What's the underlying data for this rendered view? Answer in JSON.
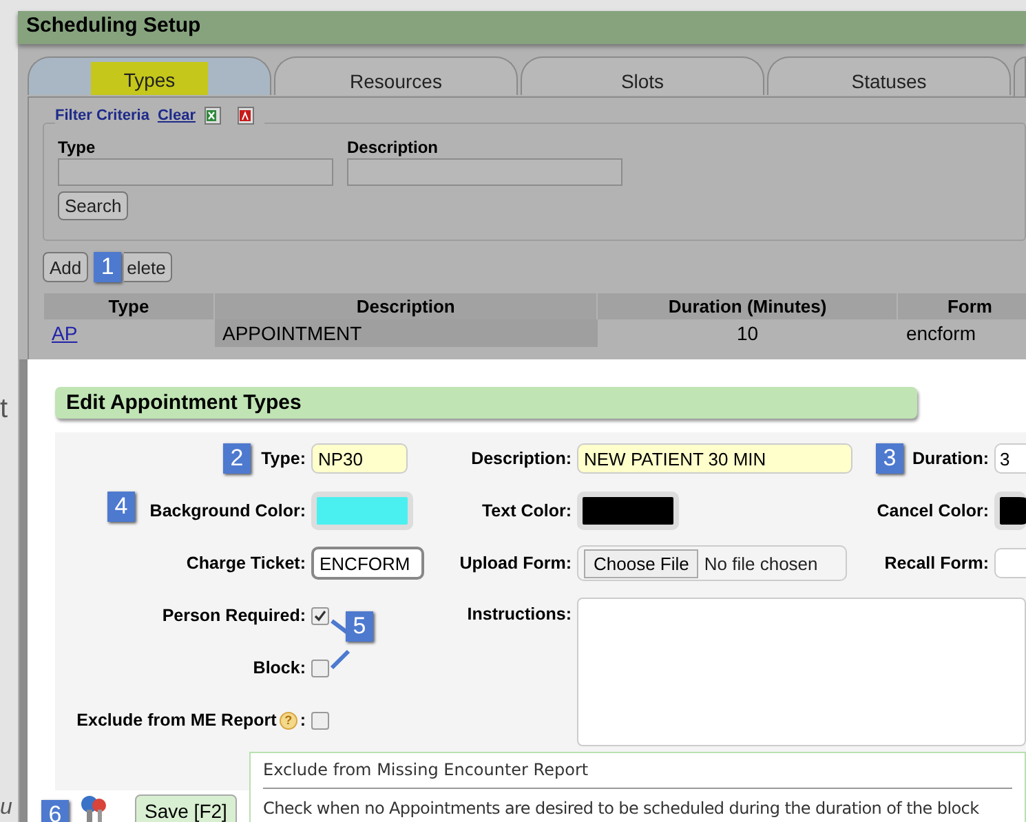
{
  "header": {
    "title": "Scheduling Setup"
  },
  "tabs": [
    {
      "label": "Types",
      "selected": true
    },
    {
      "label": "Resources",
      "selected": false
    },
    {
      "label": "Slots",
      "selected": false
    },
    {
      "label": "Statuses",
      "selected": false
    }
  ],
  "filter": {
    "legend": "Filter Criteria",
    "clear_link": "Clear",
    "fields": [
      {
        "label": "Type"
      },
      {
        "label": "Description"
      }
    ],
    "search_button": "Search"
  },
  "actions": [
    {
      "label": "Add"
    },
    {
      "label": "elete"
    }
  ],
  "table": {
    "columns": [
      "Type",
      "Description",
      "Duration (Minutes)",
      "Form"
    ],
    "rows": [
      {
        "cells": [
          "AP",
          "APPOINTMENT",
          "10",
          "encform"
        ]
      }
    ]
  },
  "edge_texts": [
    "t",
    "u"
  ],
  "dialog": {
    "title": "Edit Appointment Types",
    "rows": [
      [
        {
          "kind": "text",
          "label": "Type:",
          "value": "NP30",
          "highlighted": true
        },
        {
          "kind": "text",
          "label": "Description:",
          "value": "NEW PATIENT 30 MIN",
          "highlighted": true
        },
        {
          "kind": "text",
          "label": "Duration:",
          "value": "3",
          "highlighted": false
        }
      ],
      [
        {
          "kind": "color",
          "label": "Background Color:",
          "color": "#4af0f0"
        },
        {
          "kind": "color",
          "label": "Text Color:",
          "color": "#000000"
        },
        {
          "kind": "color",
          "label": "Cancel Color:",
          "color": "#000000"
        }
      ],
      [
        {
          "kind": "text",
          "label": "Charge Ticket:",
          "value": "ENCFORM",
          "highlighted": false
        },
        {
          "kind": "file",
          "label": "Upload Form:",
          "button": "Choose File",
          "status": "No file chosen"
        },
        {
          "kind": "text",
          "label": "Recall Form:",
          "highlighted": false
        }
      ],
      [
        {
          "kind": "checkbox",
          "label": "Person Required:",
          "checked": true
        },
        {
          "kind": "textarea",
          "label": "Instructions:"
        }
      ],
      [
        {
          "kind": "checkbox",
          "label": "Block:",
          "checked": false
        }
      ],
      [
        {
          "kind": "checkbox",
          "label": "Exclude from ME Report",
          "help_icon": "?",
          "label_end": ":",
          "checked": false
        }
      ]
    ]
  },
  "callouts": [
    {
      "label": "1"
    },
    {
      "label": "2"
    },
    {
      "label": "3"
    },
    {
      "label": "4"
    },
    {
      "label": "5"
    },
    {
      "label": "6"
    }
  ],
  "save_button": "Save [F2]",
  "tooltip": {
    "title": "Exclude from Missing Encounter Report",
    "text": "Check when no Appointments are desired to be scheduled during the duration of the block"
  }
}
